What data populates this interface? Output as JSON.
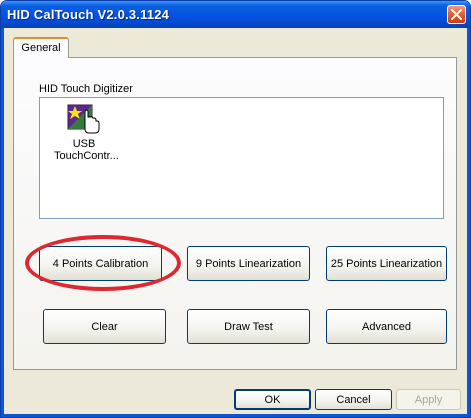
{
  "window": {
    "title": "HID CalTouch V2.0.3.1124"
  },
  "tabs": [
    {
      "label": "General"
    }
  ],
  "device_group": {
    "label": "HID Touch Digitizer",
    "devices": [
      {
        "name": "USB\nTouchContr...",
        "icon": "touch-device-icon"
      }
    ]
  },
  "buttons": {
    "calib4": "4 Points Calibration",
    "lin9": "9 Points Linearization",
    "lin25": "25 Points Linearization",
    "clear": "Clear",
    "draw_test": "Draw Test",
    "advanced": "Advanced"
  },
  "footer": {
    "ok": "OK",
    "cancel": "Cancel",
    "apply": "Apply"
  },
  "colors": {
    "titlebar": "#0554e3",
    "highlight": "#e0262e",
    "tab_accent": "#e68b2c"
  },
  "icons": {
    "close": "close-icon",
    "device": "touch-device-icon"
  }
}
